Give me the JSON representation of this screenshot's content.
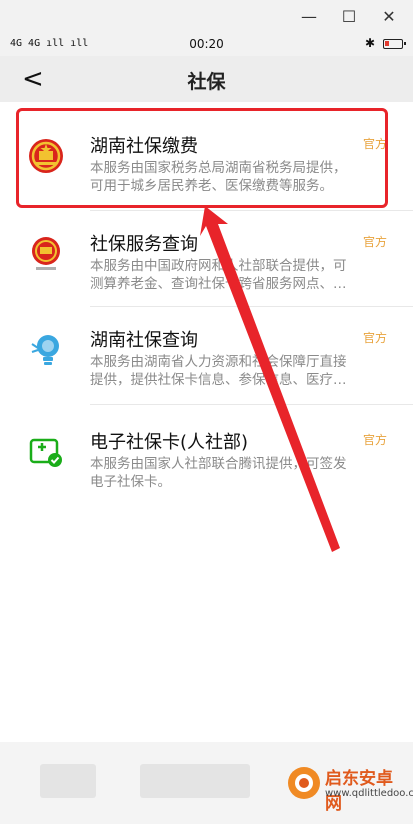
{
  "window_controls": {
    "minimize": "—",
    "maximize": "☐",
    "close": "✕"
  },
  "status": {
    "signal": "4G 4G ıll ıll",
    "time": "00:20",
    "bluetooth": "✱"
  },
  "header": {
    "back": "<",
    "title": "社保"
  },
  "items": [
    {
      "name": "湖南社保缴费",
      "official": "官方",
      "desc1": "本服务由国家税务总局湖南省税务局提供，",
      "desc2": "可用于城乡居民养老、医保缴费等服务。",
      "icon": "national-emblem-icon"
    },
    {
      "name": "社保服务查询",
      "official": "官方",
      "desc1": "本服务由中国政府网和人社部联合提供，可",
      "desc2": "测算养老金、查询社保卡跨省服务网点、…",
      "icon": "gov-emblem-icon"
    },
    {
      "name": "湖南社保查询",
      "official": "官方",
      "desc1": "本服务由湖南省人力资源和社会保障厅直接",
      "desc2": "提供，提供社保卡信息、参保信息、医疗…",
      "icon": "lightbulb-icon"
    },
    {
      "name": "电子社保卡(人社部)",
      "official": "官方",
      "desc1": "本服务由国家人社部联合腾讯提供，可签发",
      "desc2": "电子社保卡。",
      "icon": "social-security-card-icon"
    }
  ],
  "watermark": {
    "title": "启东安卓网",
    "url": "www.qdlittledoo.com"
  },
  "colors": {
    "highlight": "#e8242a",
    "official": "#e8a33d",
    "accent_green": "#1aad19"
  }
}
